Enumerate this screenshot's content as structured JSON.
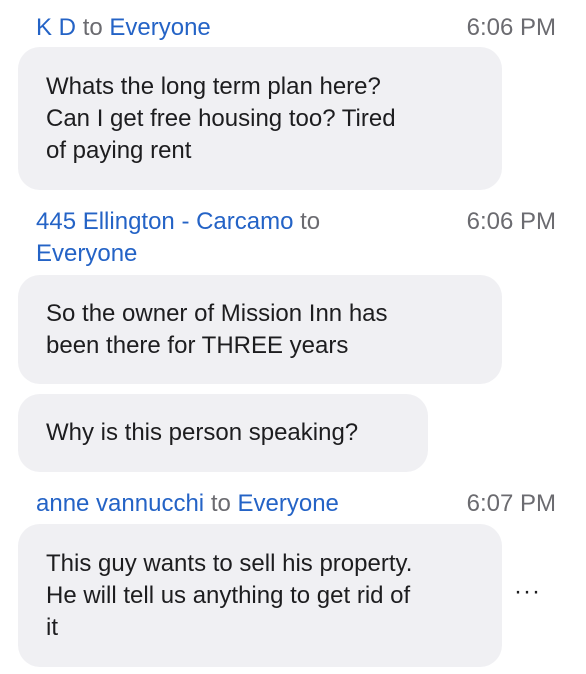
{
  "messages": [
    {
      "sender": "K D",
      "connector": "to",
      "recipient": "Everyone",
      "time": "6:06 PM",
      "text_lines": [
        "Whats the long term plan here?",
        "Can I get free housing too? Tired",
        "of paying rent"
      ]
    },
    {
      "sender": "445 Ellington - Carcamo",
      "connector": "to",
      "recipient": "Everyone",
      "time": "6:06 PM",
      "bubbles": [
        {
          "text_lines": [
            "So the owner of Mission Inn has",
            "been there for THREE years"
          ]
        },
        {
          "text_lines": [
            "Why is this person speaking?"
          ]
        }
      ]
    },
    {
      "sender": "anne vannucchi",
      "connector": "to",
      "recipient": "Everyone",
      "time": "6:07 PM",
      "text_lines": [
        "This guy wants to sell his property.",
        "He will tell us anything to get rid of",
        "it"
      ]
    }
  ],
  "more_icon": "···",
  "colors": {
    "sender": "#2463c6",
    "meta": "#6b6b70",
    "bubble": "#f0f0f3",
    "text": "#1d1d1f"
  }
}
